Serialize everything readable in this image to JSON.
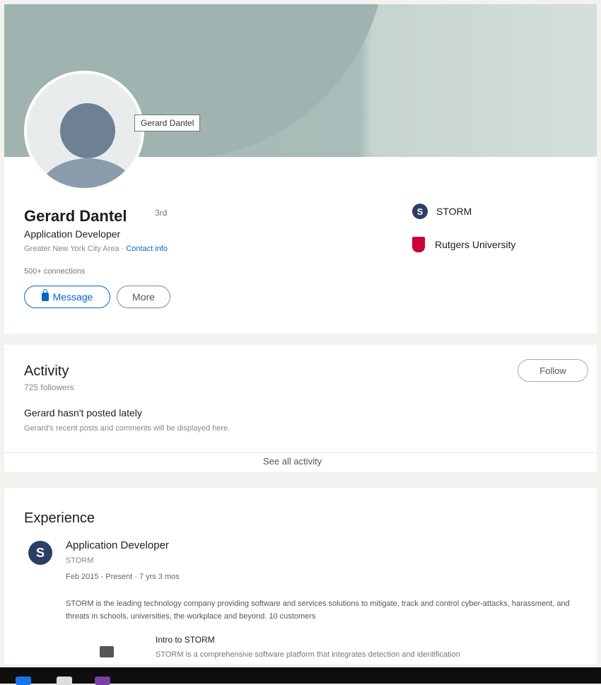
{
  "profile": {
    "tooltip": "Gerard Dantel",
    "name": "Gerard Dantel",
    "pronoun": "3rd",
    "headline": "Application Developer",
    "location": "Greater New York City Area · Contact info",
    "contact_link": "Contact info",
    "connections": "500+ connections",
    "message_label": "Message",
    "more_label": "More"
  },
  "orgs": [
    {
      "name": "STORM"
    },
    {
      "name": "Rutgers University"
    }
  ],
  "activity": {
    "title": "Activity",
    "followers": "725 followers",
    "follow_label": "Follow",
    "not_posted": "Gerard hasn't posted lately",
    "posts_note": "Gerard's recent posts and comments will be displayed here.",
    "see_all": "See all activity"
  },
  "experience": {
    "title": "Experience",
    "job_title": "Application Developer",
    "company": "STORM",
    "dates": "Feb 2015 - Present · 7 yrs 3 mos",
    "description": "STORM is the leading technology company providing software and services solutions to mitigate, track and control cyber-attacks, harassment, and threats in schools, universities, the workplace and beyond. 10 customers",
    "media_title": "Intro to STORM",
    "media_description": "STORM is a comprehensive software platform that integrates detection and identification"
  },
  "colors": {
    "accent": "#0a66c2",
    "rutgers_red": "#cc0033",
    "storm_navy": "#2c3e66"
  }
}
